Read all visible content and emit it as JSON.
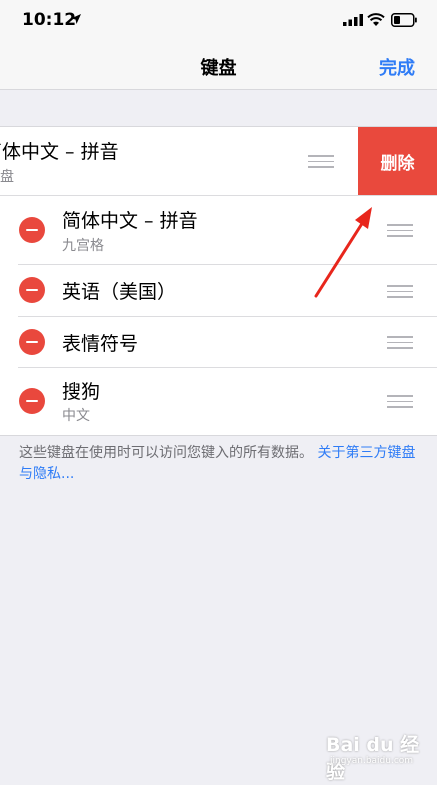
{
  "status_bar": {
    "time": "10:12"
  },
  "nav": {
    "title": "键盘",
    "done_label": "完成"
  },
  "swiped_row": {
    "name": "简体中文 – 拼音",
    "subtitle": "键盘",
    "delete_label": "删除"
  },
  "keyboards": [
    {
      "name": "简体中文 – 拼音",
      "subtitle": "九宫格"
    },
    {
      "name": "英语（美国）",
      "subtitle": ""
    },
    {
      "name": "表情符号",
      "subtitle": ""
    },
    {
      "name": "搜狗",
      "subtitle": "中文"
    }
  ],
  "footer": {
    "text": "这些键盘在使用时可以访问您键入的所有数据。",
    "link": "关于第三方键盘与隐私..."
  },
  "watermark": {
    "main": "Bai du 经验",
    "sub": "jingyan.baidu.com"
  },
  "colors": {
    "accent": "#2f7cf6",
    "delete": "#e9493d",
    "background": "#efeff4"
  },
  "icons": [
    "location-arrow-icon",
    "signal-icon",
    "wifi-icon",
    "battery-icon",
    "minus-circle-icon",
    "reorder-grip-icon",
    "red-arrow-annotation"
  ]
}
